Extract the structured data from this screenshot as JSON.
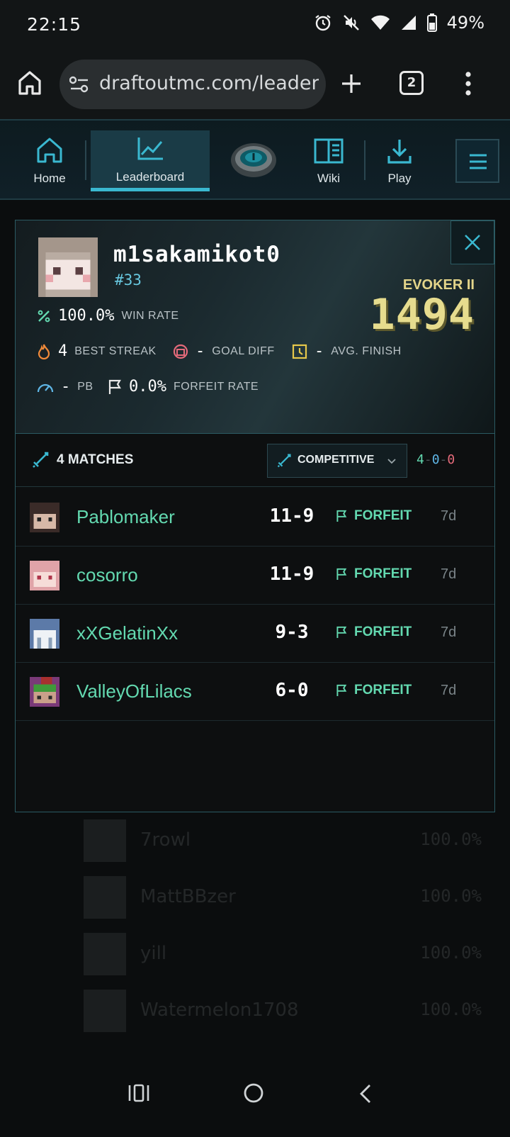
{
  "status_bar": {
    "time": "22:15",
    "battery": "49%"
  },
  "browser": {
    "url": "draftoutmc.com/leaderb",
    "tab_count": "2"
  },
  "site_nav": {
    "items": [
      {
        "label": "Home"
      },
      {
        "label": "Leaderboard"
      },
      {
        "label": "Wiki"
      },
      {
        "label": "Play"
      }
    ]
  },
  "profile": {
    "name": "m1sakamikot0",
    "rank": "#33",
    "tier": "EVOKER II",
    "elo": "1494",
    "win_rate": {
      "value": "100.0%",
      "label": "WIN RATE"
    },
    "best_streak": {
      "value": "4",
      "label": "BEST STREAK"
    },
    "goal_diff": {
      "value": "-",
      "label": "GOAL DIFF"
    },
    "avg_finish": {
      "value": "-",
      "label": "AVG. FINISH"
    },
    "pb": {
      "value": "-",
      "label": "PB"
    },
    "forfeit_rate": {
      "value": "0.0%",
      "label": "FORFEIT RATE"
    }
  },
  "matches": {
    "title": "4 MATCHES",
    "mode": "COMPETITIVE",
    "record": {
      "wins": "4",
      "draws": "0",
      "losses": "0",
      "sep": "-"
    },
    "rows": [
      {
        "name": "Pablomaker",
        "score": "11-9",
        "result": "FORFEIT",
        "age": "7d"
      },
      {
        "name": "cosorro",
        "score": "11-9",
        "result": "FORFEIT",
        "age": "7d"
      },
      {
        "name": "xXGelatinXx",
        "score": "9-3",
        "result": "FORFEIT",
        "age": "7d"
      },
      {
        "name": "ValleyOfLilacs",
        "score": "6-0",
        "result": "FORFEIT",
        "age": "7d"
      }
    ]
  },
  "background_list": [
    {
      "name": "7rowl",
      "pct": "100.0%"
    },
    {
      "name": "MattBBzer",
      "pct": "100.0%"
    },
    {
      "name": "yill",
      "pct": "100.0%"
    },
    {
      "name": "Watermelon1708",
      "pct": "100.0%"
    }
  ],
  "colors": {
    "accent": "#3ab8d0",
    "player_name": "#63d9b0",
    "elo": "#e6dc8e",
    "win": "#63d9b0",
    "draw": "#5fb6e6",
    "loss": "#e56a7a"
  }
}
